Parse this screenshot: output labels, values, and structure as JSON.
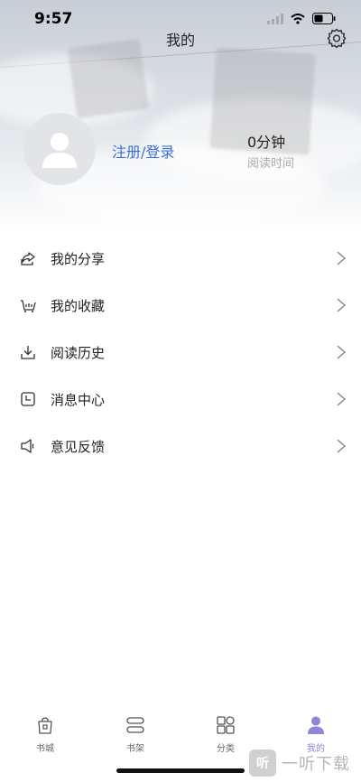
{
  "status_bar": {
    "time": "9:57"
  },
  "header": {
    "title": "我的"
  },
  "profile": {
    "login_label": "注册/登录",
    "reading_time": "0分钟",
    "reading_label": "阅读时间"
  },
  "menu": [
    {
      "label": "我的分享",
      "icon": "share-icon"
    },
    {
      "label": "我的收藏",
      "icon": "favorites-icon"
    },
    {
      "label": "阅读历史",
      "icon": "download-history-icon"
    },
    {
      "label": "消息中心",
      "icon": "message-icon"
    },
    {
      "label": "意见反馈",
      "icon": "feedback-icon"
    }
  ],
  "tabs": [
    {
      "label": "书城",
      "icon": "bookstore-icon"
    },
    {
      "label": "书架",
      "icon": "bookshelf-icon"
    },
    {
      "label": "分类",
      "icon": "category-icon"
    },
    {
      "label": "我的",
      "icon": "profile-icon",
      "active": true
    }
  ],
  "watermark": {
    "text": "一听下载",
    "badge": "听"
  },
  "colors": {
    "accent": "#3b6fd8",
    "active_tab": "#8d86d9",
    "text": "#222222",
    "muted": "#a7aab0"
  }
}
